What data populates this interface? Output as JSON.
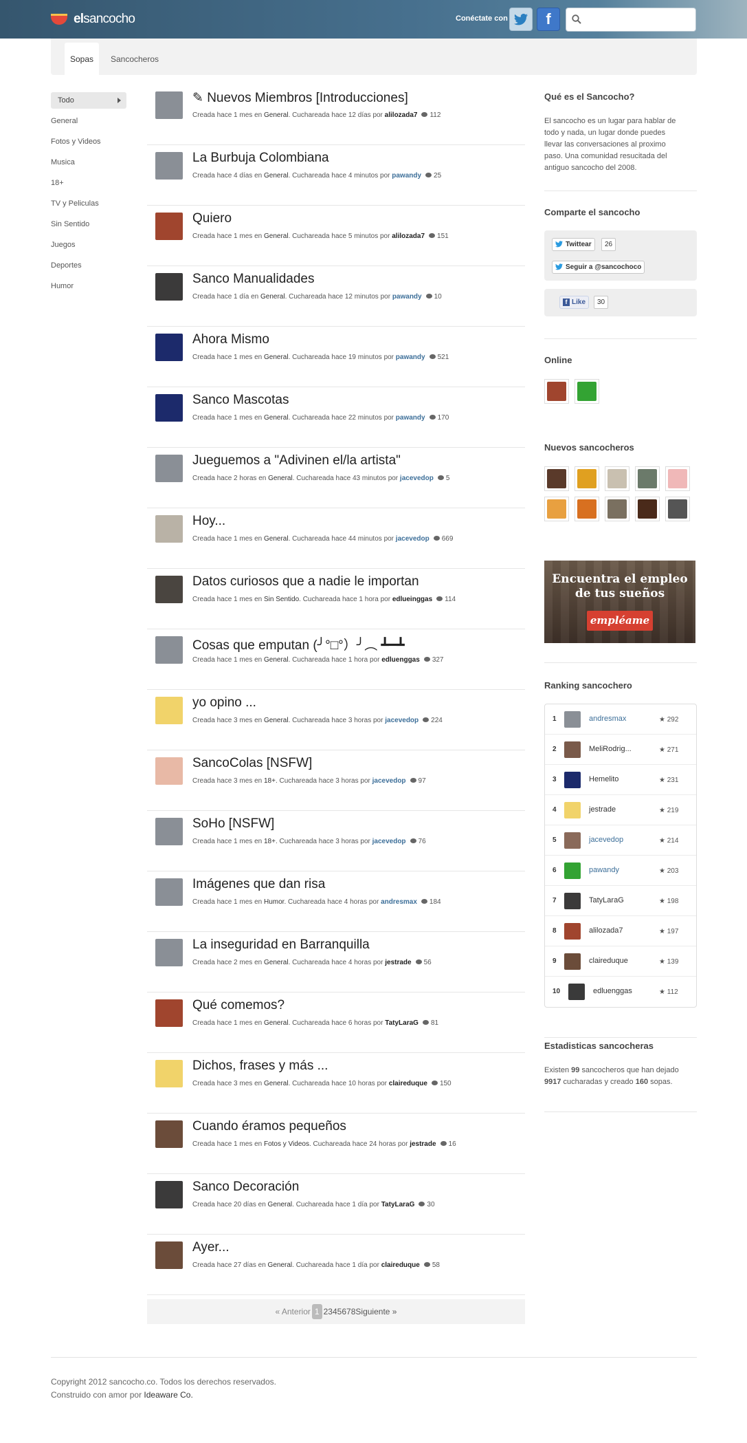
{
  "header": {
    "logo_bold": "el",
    "logo_rest": "sancocho",
    "connect_label": "Conéctate con",
    "facebook_glyph": "f",
    "search_placeholder": ""
  },
  "subnav": {
    "tabs": [
      {
        "label": "Sopas",
        "active": true
      },
      {
        "label": "Sancocheros",
        "active": false
      }
    ]
  },
  "categories": [
    "Todo",
    "General",
    "Fotos y Videos",
    "Musica",
    "18+",
    "TV y Peliculas",
    "Sin Sentido",
    "Juegos",
    "Deportes",
    "Humor"
  ],
  "topics": [
    {
      "prefix": "✎ ",
      "title": "Nuevos Miembros [Introducciones]",
      "created": "hace 1 mes",
      "category": "General",
      "stirred": "hace 12 días",
      "user": "alilozada7",
      "user_link": false,
      "comments": "112",
      "avatar_color": "#8a8f96"
    },
    {
      "prefix": "",
      "title": "La Burbuja Colombiana",
      "created": "hace 4 días",
      "category": "General",
      "stirred": "hace 4 minutos",
      "user": "pawandy",
      "user_link": true,
      "comments": "25",
      "avatar_color": "#8a8f96"
    },
    {
      "prefix": "",
      "title": "Quiero",
      "created": "hace 1 mes",
      "category": "General",
      "stirred": "hace 5 minutos",
      "user": "alilozada7",
      "user_link": false,
      "comments": "151",
      "avatar_color": "#a0452e"
    },
    {
      "prefix": "",
      "title": "Sanco Manualidades",
      "created": "hace 1 día",
      "category": "General",
      "stirred": "hace 12 minutos",
      "user": "pawandy",
      "user_link": true,
      "comments": "10",
      "avatar_color": "#3b3a3a"
    },
    {
      "prefix": "",
      "title": "Ahora Mismo",
      "created": "hace 1 mes",
      "category": "General",
      "stirred": "hace 19 minutos",
      "user": "pawandy",
      "user_link": true,
      "comments": "521",
      "avatar_color": "#1c2a6b"
    },
    {
      "prefix": "",
      "title": "Sanco Mascotas",
      "created": "hace 1 mes",
      "category": "General",
      "stirred": "hace 22 minutos",
      "user": "pawandy",
      "user_link": true,
      "comments": "170",
      "avatar_color": "#1c2a6b"
    },
    {
      "prefix": "",
      "title": "Jueguemos a \"Adivinen el/la artista\"",
      "created": "hace 2 horas",
      "category": "General",
      "stirred": "hace 43 minutos",
      "user": "jacevedop",
      "user_link": true,
      "comments": "5",
      "avatar_color": "#8a8f96"
    },
    {
      "prefix": "",
      "title": "Hoy...",
      "created": "hace 1 mes",
      "category": "General",
      "stirred": "hace 44 minutos",
      "user": "jacevedop",
      "user_link": true,
      "comments": "669",
      "avatar_color": "#b9b2a6"
    },
    {
      "prefix": "",
      "title": "Datos curiosos que a nadie le importan",
      "created": "hace 1 mes",
      "category": "Sin Sentido",
      "stirred": "hace 1 hora",
      "user": "edlueinggas",
      "user_link": false,
      "comments": "114",
      "avatar_color": "#4a4540"
    },
    {
      "prefix": "",
      "title": "Cosas que emputan (╯°□°）╯︵ ┻━┻",
      "created": "hace 1 mes",
      "category": "General",
      "stirred": "hace 1 hora",
      "user": "edluenggas",
      "user_link": false,
      "comments": "327",
      "avatar_color": "#8a8f96"
    },
    {
      "prefix": "",
      "title": "yo opino ...",
      "created": "hace 3 mes",
      "category": "General",
      "stirred": "hace 3 horas",
      "user": "jacevedop",
      "user_link": true,
      "comments": "224",
      "avatar_color": "#f1d36a"
    },
    {
      "prefix": "",
      "title": "SancoColas [NSFW]",
      "created": "hace 3 mes",
      "category": "18+",
      "stirred": "hace 3 horas",
      "user": "jacevedop",
      "user_link": true,
      "comments": "97",
      "avatar_color": "#e8b9a6"
    },
    {
      "prefix": "",
      "title": "SoHo [NSFW]",
      "created": "hace 1 mes",
      "category": "18+",
      "stirred": "hace 3 horas",
      "user": "jacevedop",
      "user_link": true,
      "comments": "76",
      "avatar_color": "#8a8f96"
    },
    {
      "prefix": "",
      "title": "Imágenes que dan risa",
      "created": "hace 1 mes",
      "category": "Humor",
      "stirred": "hace 4 horas",
      "user": "andresmax",
      "user_link": true,
      "comments": "184",
      "avatar_color": "#8a8f96"
    },
    {
      "prefix": "",
      "title": "La inseguridad en Barranquilla",
      "created": "hace 2 mes",
      "category": "General",
      "stirred": "hace 4 horas",
      "user": "jestrade",
      "user_link": false,
      "comments": "56",
      "avatar_color": "#8a8f96"
    },
    {
      "prefix": "",
      "title": "Qué comemos?",
      "created": "hace 1 mes",
      "category": "General",
      "stirred": "hace 6 horas",
      "user": "TatyLaraG",
      "user_link": false,
      "comments": "81",
      "avatar_color": "#a0452e"
    },
    {
      "prefix": "",
      "title": "Dichos, frases y más ...",
      "created": "hace 3 mes",
      "category": "General",
      "stirred": "hace 10 horas",
      "user": "claireduque",
      "user_link": false,
      "comments": "150",
      "avatar_color": "#f1d36a"
    },
    {
      "prefix": "",
      "title": "Cuando éramos pequeños",
      "created": "hace 1 mes",
      "category": "Fotos y Videos",
      "stirred": "hace 24 horas",
      "user": "jestrade",
      "user_link": false,
      "comments": "16",
      "avatar_color": "#6b4c3a"
    },
    {
      "prefix": "",
      "title": "Sanco Decoración",
      "created": "hace 20 días",
      "category": "General",
      "stirred": "hace 1 día",
      "user": "TatyLaraG",
      "user_link": false,
      "comments": "30",
      "avatar_color": "#3b3a3a"
    },
    {
      "prefix": "",
      "title": "Ayer...",
      "created": "hace 27 días",
      "category": "General",
      "stirred": "hace 1 día",
      "user": "claireduque",
      "user_link": false,
      "comments": "58",
      "avatar_color": "#6b4c3a"
    }
  ],
  "topic_labels": {
    "created": "Creada",
    "in": "en",
    "stirred": "Cuchareada",
    "by": "por"
  },
  "pagination": {
    "prev": "« Anterior",
    "pages": [
      "1",
      "2",
      "3",
      "4",
      "5",
      "6",
      "7",
      "8"
    ],
    "current": "1",
    "next": "Siguiente »"
  },
  "sidebar": {
    "about_title": "Qué es el Sancocho?",
    "about_text": "El sancocho es un lugar para hablar de todo y nada, un lugar donde puedes llevar las conversaciones al proximo paso. Una comunidad resucitada del antiguo sancocho del 2008.",
    "share_title": "Comparte el sancocho",
    "tweet_label": "Twittear",
    "tweet_count": "26",
    "follow_label": "Seguir a @sancochoco",
    "like_label": "Like",
    "like_count": "30",
    "online_title": "Online",
    "online_colors": [
      "#a0452e",
      "#33a333"
    ],
    "new_title": "Nuevos sancocheros",
    "new_colors": [
      "#5a3a2a",
      "#e0a020",
      "#c9c0b0",
      "#6b7a6a",
      "#f0b8b8",
      "#e8a040",
      "#d87020",
      "#7a7060",
      "#4a2a1a",
      "#555555"
    ],
    "ad_line1": "Encuentra el empleo",
    "ad_line2": "de tus sueños",
    "ad_button": "empléame",
    "ranking_title": "Ranking sancochero",
    "ranking": [
      {
        "rank": "1",
        "name": "andresmax",
        "points": "292",
        "link": true,
        "color": "#8a8f96"
      },
      {
        "rank": "2",
        "name": "MeliRodrig...",
        "points": "271",
        "link": false,
        "color": "#7a5a4a"
      },
      {
        "rank": "3",
        "name": "Hemelito",
        "points": "231",
        "link": false,
        "color": "#1c2a6b"
      },
      {
        "rank": "4",
        "name": "jestrade",
        "points": "219",
        "link": false,
        "color": "#f1d36a"
      },
      {
        "rank": "5",
        "name": "jacevedop",
        "points": "214",
        "link": true,
        "color": "#8a6a5a"
      },
      {
        "rank": "6",
        "name": "pawandy",
        "points": "203",
        "link": true,
        "color": "#33a333"
      },
      {
        "rank": "7",
        "name": "TatyLaraG",
        "points": "198",
        "link": false,
        "color": "#3b3a3a"
      },
      {
        "rank": "8",
        "name": "alilozada7",
        "points": "197",
        "link": false,
        "color": "#a0452e"
      },
      {
        "rank": "9",
        "name": "claireduque",
        "points": "139",
        "link": false,
        "color": "#6b4c3a"
      },
      {
        "rank": "10",
        "name": "edluenggas",
        "points": "112",
        "link": false,
        "color": "#3a3a3a"
      }
    ],
    "stats_title": "Estadisticas sancocheras",
    "stats_pre": "Existen ",
    "stats_users": "99",
    "stats_mid1": " sancocheros que han dejado ",
    "stats_spoons": "9917",
    "stats_mid2": " cucharadas y creado ",
    "stats_soups": "160",
    "stats_post": " sopas."
  },
  "footer": {
    "copyright": "Copyright 2012 sancocho.co. Todos los derechos reservados.",
    "built_pre": "Construido con amor por ",
    "built_link": "Ideaware Co."
  },
  "colors": {
    "accent_blue": "#3d6f99",
    "header_bg": "#47708e"
  },
  "icons": [
    "search-icon",
    "twitter-icon",
    "facebook-icon",
    "comment-icon",
    "star-icon",
    "chevron-right-icon"
  ]
}
